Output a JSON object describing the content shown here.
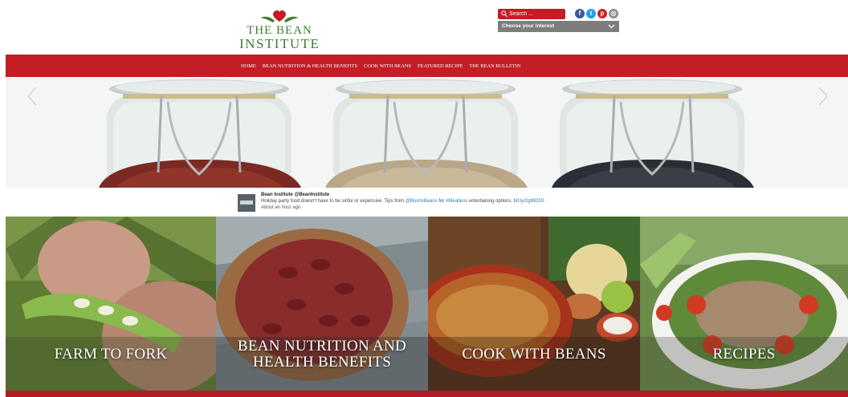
{
  "brand": {
    "line1": "THE BEAN",
    "line2": "INSTITUTE"
  },
  "search": {
    "placeholder": "Search ..."
  },
  "social": [
    {
      "name": "facebook",
      "glyph": "f",
      "color": "#3b5998"
    },
    {
      "name": "twitter",
      "glyph": "t",
      "color": "#1da1f2"
    },
    {
      "name": "pinterest",
      "glyph": "p",
      "color": "#cb2027"
    },
    {
      "name": "instagram",
      "glyph": "◎",
      "color": "#8a8a8a"
    }
  ],
  "interest_select": {
    "value": "Choose your interest"
  },
  "nav": {
    "items": [
      {
        "label": "HOME"
      },
      {
        "label": "BEAN NUTRITION & HEALTH BENEFITS"
      },
      {
        "label": "COOK WITH BEANS"
      },
      {
        "label": "FEATURED RECIPE"
      },
      {
        "label": "THE BEAN BULLETIN"
      }
    ]
  },
  "tweet": {
    "author": "Bean Institute @BeanInstitute",
    "text": "Holiday party food doesn't have to be sinful or expensive. Tips from ",
    "mention": "@BushsBeans",
    "text2": " for ",
    "hashtag": "#Meatless",
    "text3": " entertaining options. ",
    "link": "bit.ly/2gtBD5S",
    "time": "About an hour ago"
  },
  "tiles": [
    {
      "label": "FARM TO FORK"
    },
    {
      "label_line1": "BEAN NUTRITION AND",
      "label_line2": "HEALTH BENEFITS"
    },
    {
      "label": "COOK WITH BEANS"
    },
    {
      "label": "RECIPES"
    }
  ],
  "colors": {
    "brand_red": "#c31d26",
    "brand_green": "#3f7d2e",
    "select_gray": "#7d7d7d"
  }
}
